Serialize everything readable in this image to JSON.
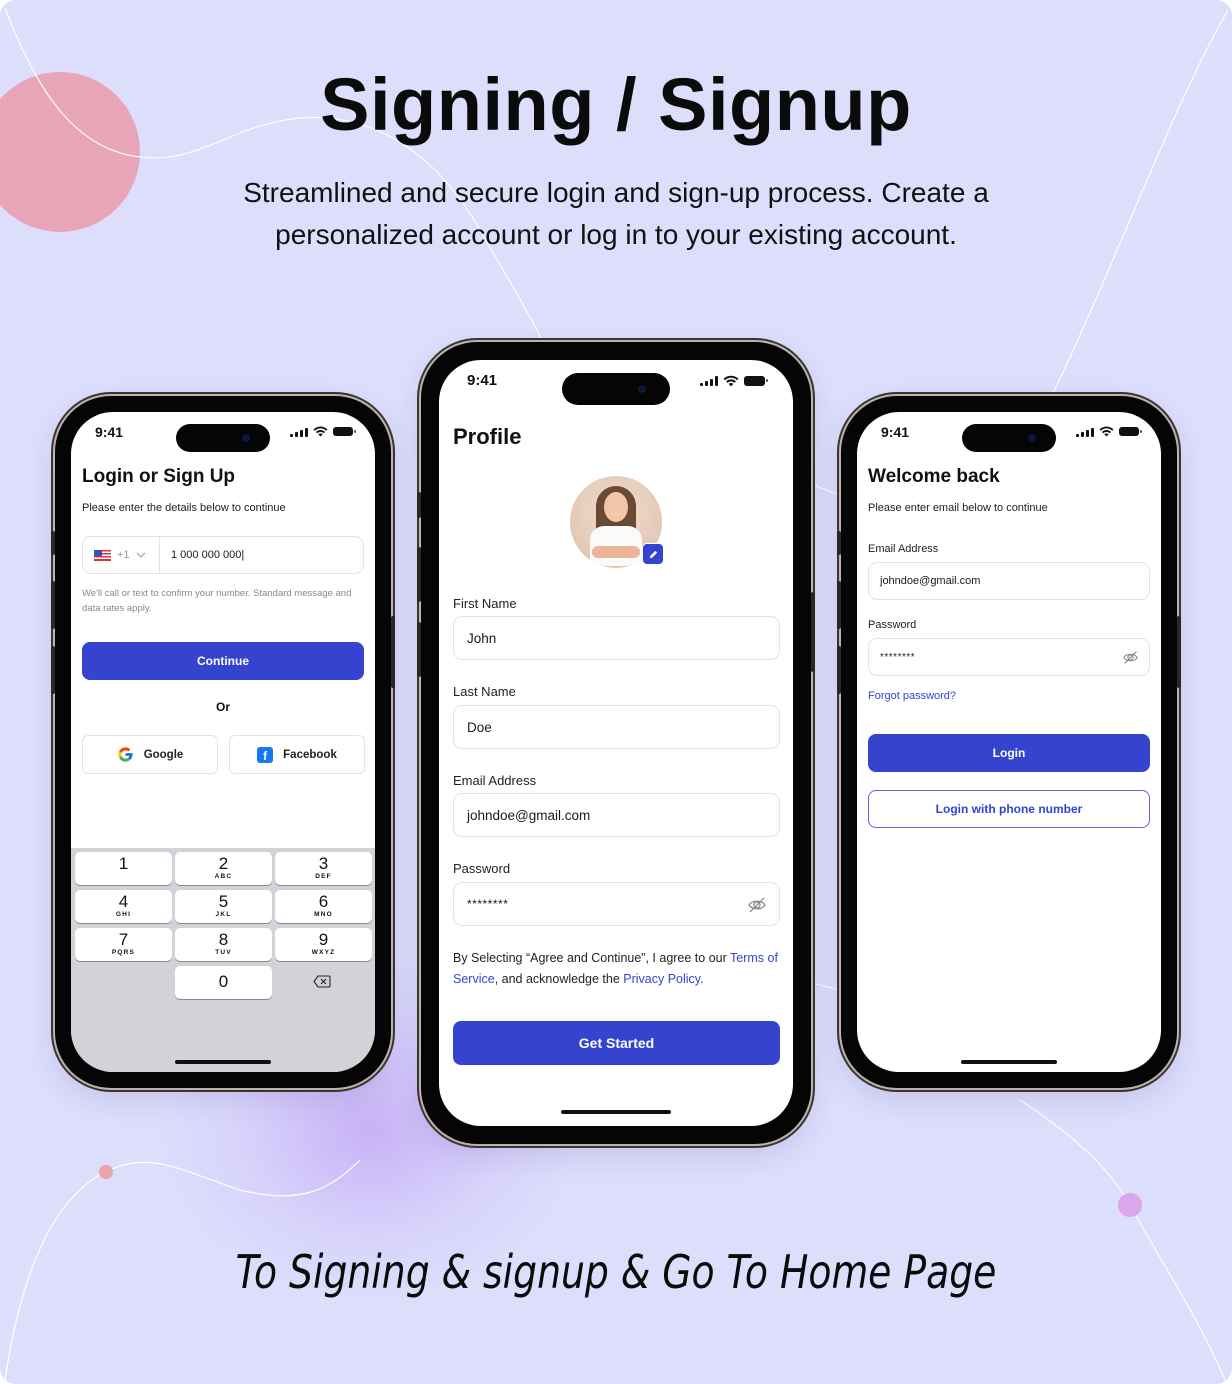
{
  "hero": {
    "title": "Signing / Signup",
    "subtitle": "Streamlined and secure login and sign-up process. Create a personalized account or log in to your existing account.",
    "footer_caption": "To Signing & signup & Go To Home Page"
  },
  "theme": {
    "background": "#dcdefc",
    "accent": "#3444cf",
    "blob_pink": "#e9a5b8"
  },
  "status_bar": {
    "time": "9:41"
  },
  "login_signup": {
    "title": "Login or Sign Up",
    "subtitle": "Please enter the details below to continue",
    "country_code": "+1",
    "phone_value": "1 000 000 000|",
    "disclaimer": "We'll call or text to confirm your number. Standard message and data rates apply.",
    "continue_label": "Continue",
    "or_label": "Or",
    "google_label": "Google",
    "facebook_label": "Facebook",
    "keypad": [
      {
        "num": "1",
        "letters": ""
      },
      {
        "num": "2",
        "letters": "ABC"
      },
      {
        "num": "3",
        "letters": "DEF"
      },
      {
        "num": "4",
        "letters": "GHI"
      },
      {
        "num": "5",
        "letters": "JKL"
      },
      {
        "num": "6",
        "letters": "MNO"
      },
      {
        "num": "7",
        "letters": "PQRS"
      },
      {
        "num": "8",
        "letters": "TUV"
      },
      {
        "num": "9",
        "letters": "WXYZ"
      },
      {
        "num": "0",
        "letters": ""
      }
    ]
  },
  "profile": {
    "title": "Profile",
    "first_name_label": "First Name",
    "first_name_value": "John",
    "last_name_label": "Last Name",
    "last_name_value": "Doe",
    "email_label": "Email Address",
    "email_value": "johndoe@gmail.com",
    "password_label": "Password",
    "password_value": "********",
    "terms_prefix": "By Selecting “Agree and Continue”, I agree to our ",
    "terms_link": "Terms of Service",
    "terms_middle": ", and acknowledge the ",
    "privacy_link": "Privacy Policy",
    "terms_suffix": ".",
    "get_started_label": "Get Started"
  },
  "welcome_back": {
    "title": "Welcome back",
    "subtitle": "Please enter email below to continue",
    "email_label": "Email Address",
    "email_value": "johndoe@gmail.com",
    "password_label": "Password",
    "password_value": "********",
    "forgot_label": "Forgot password?",
    "login_label": "Login",
    "phone_login_label": "Login with phone number"
  }
}
